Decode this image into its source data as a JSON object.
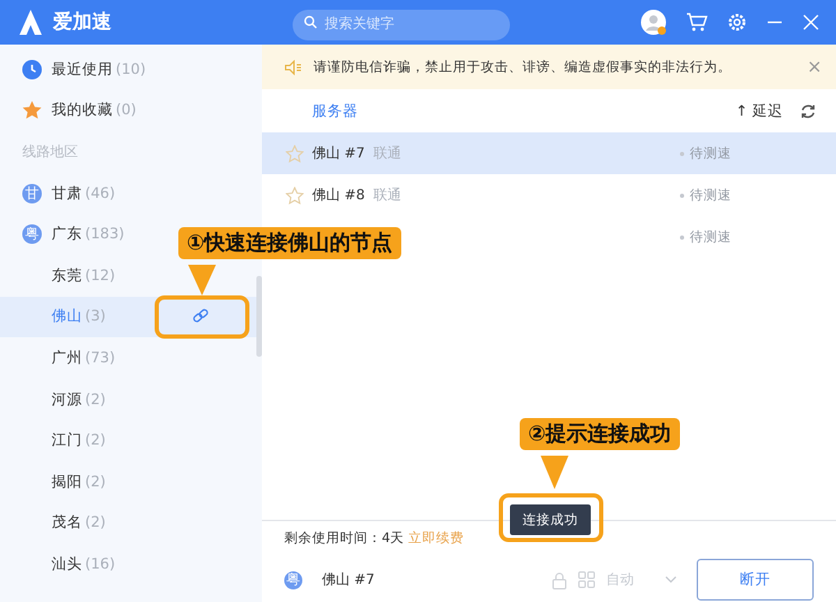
{
  "app": {
    "brand": "爱加速",
    "search_placeholder": "搜索关键字"
  },
  "sidebar": {
    "items": [
      {
        "kind": "category",
        "label": "最近使用",
        "count": "(10)",
        "selected": false
      },
      {
        "kind": "category",
        "label": "我的收藏",
        "count": "(0)",
        "selected": false
      },
      {
        "kind": "section",
        "label": "线路地区"
      },
      {
        "kind": "region",
        "badge": "甘",
        "label": "甘肃",
        "count": "(46)",
        "selected": false
      },
      {
        "kind": "region",
        "badge": "粤",
        "label": "广东",
        "count": "(183)",
        "selected": false
      },
      {
        "kind": "city",
        "label": "东莞",
        "count": "(12)",
        "selected": false
      },
      {
        "kind": "city",
        "label": "佛山",
        "count": "(3)",
        "selected": true
      },
      {
        "kind": "city",
        "label": "广州",
        "count": "(73)",
        "selected": false
      },
      {
        "kind": "city",
        "label": "河源",
        "count": "(2)",
        "selected": false
      },
      {
        "kind": "city",
        "label": "江门",
        "count": "(2)",
        "selected": false
      },
      {
        "kind": "city",
        "label": "揭阳",
        "count": "(2)",
        "selected": false
      },
      {
        "kind": "city",
        "label": "茂名",
        "count": "(2)",
        "selected": false
      },
      {
        "kind": "city",
        "label": "汕头",
        "count": "(16)",
        "selected": false
      }
    ]
  },
  "notice": {
    "text": "请谨防电信诈骗，禁止用于攻击、诽谤、编造虚假事实的非法行为。",
    "close": "×"
  },
  "servers": {
    "columns": [
      "服务器",
      "↑ 延迟"
    ],
    "rows": [
      {
        "name": "佛山 #7",
        "isp": "联通",
        "status": "待测速",
        "selected": true
      },
      {
        "name": "佛山 #8",
        "isp": "联通",
        "status": "待测速",
        "selected": false
      },
      {
        "status": "待测速",
        "selected": false
      }
    ]
  },
  "footer": {
    "remaining": "剩余使用时间：4天",
    "renew": "立即续费",
    "badge": "粤",
    "current": "佛山 #7",
    "mode": "自动",
    "disconnect": "断开"
  },
  "toast": "连接成功",
  "callouts": [
    "①快速连接佛山的节点",
    "②提示连接成功"
  ]
}
